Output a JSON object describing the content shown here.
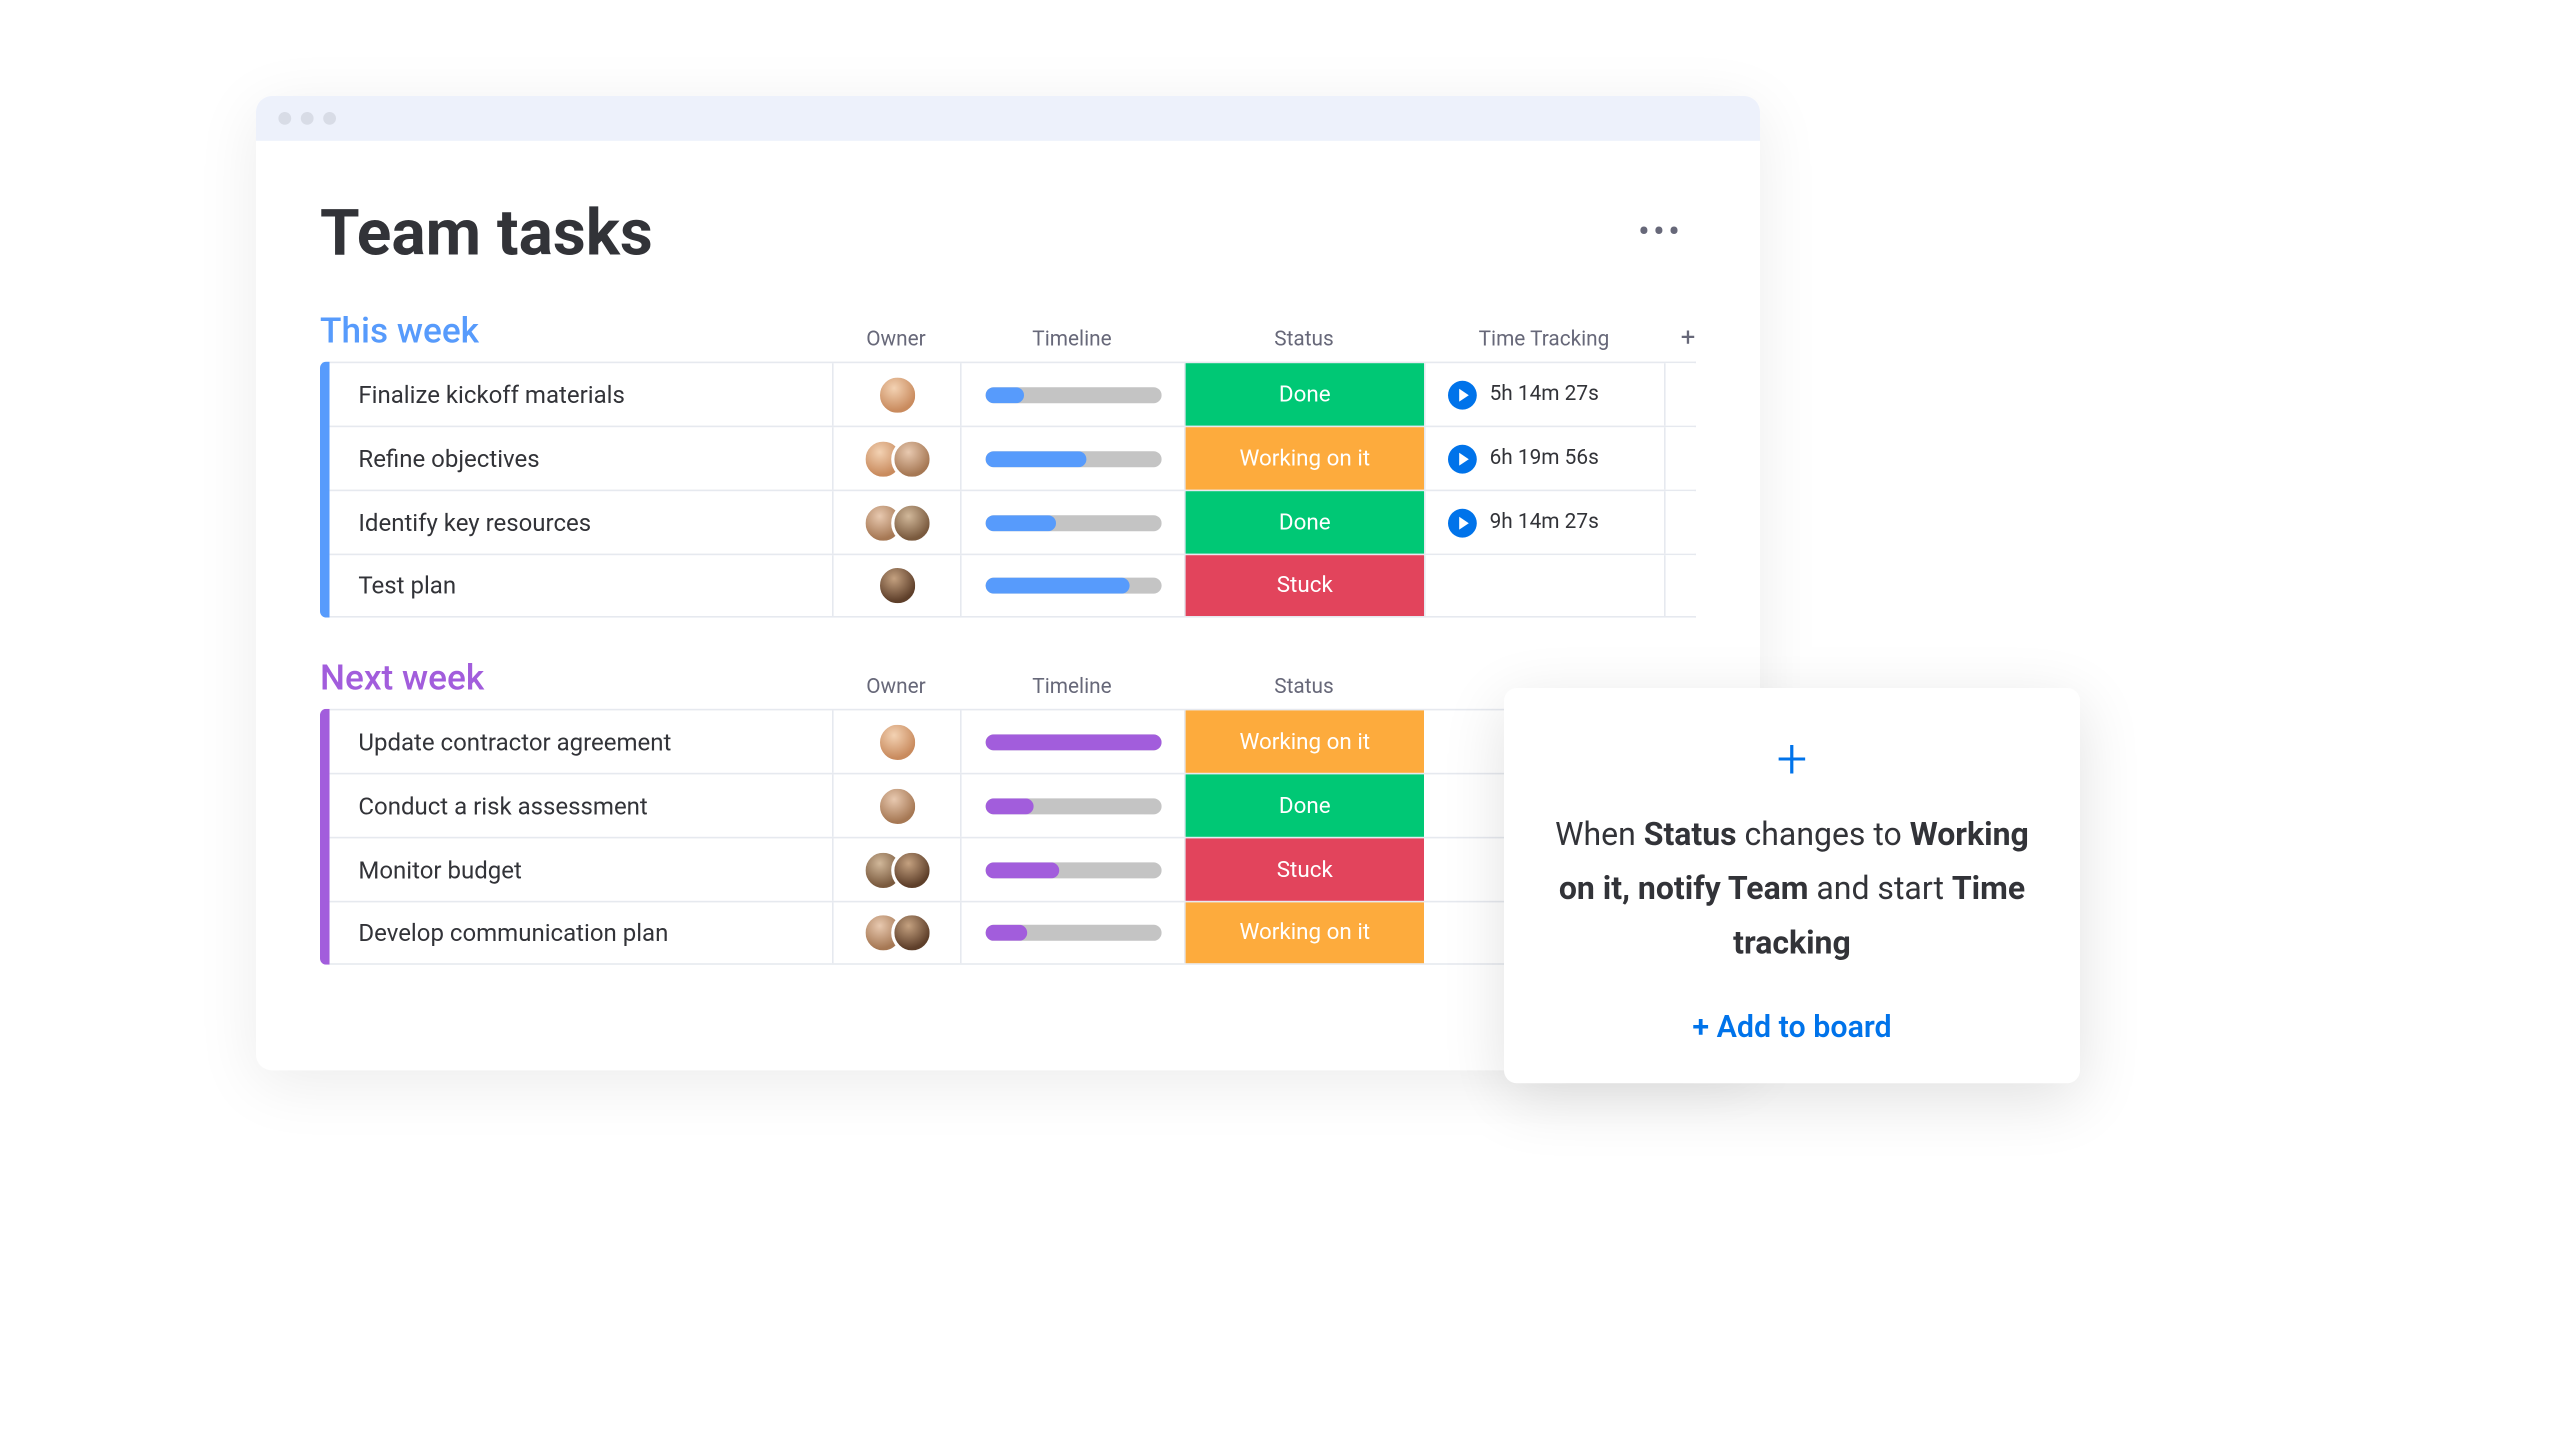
{
  "page_title": "Team tasks",
  "columns": {
    "owner": "Owner",
    "timeline": "Timeline",
    "status": "Status",
    "time_tracking": "Time Tracking"
  },
  "groups": [
    {
      "title": "This week",
      "color": "blue",
      "rows": [
        {
          "name": "Finalize kickoff materials",
          "owners": [
            "av1"
          ],
          "progress": 22,
          "status": "Done",
          "status_class": "done",
          "time": "5h 14m 27s"
        },
        {
          "name": "Refine objectives",
          "owners": [
            "av1",
            "av2"
          ],
          "progress": 58,
          "status": "Working on it",
          "status_class": "working",
          "time": "6h 19m 56s"
        },
        {
          "name": "Identify key resources",
          "owners": [
            "av2",
            "av3"
          ],
          "progress": 40,
          "status": "Done",
          "status_class": "done",
          "time": "9h 14m 27s"
        },
        {
          "name": "Test plan",
          "owners": [
            "av4"
          ],
          "progress": 82,
          "status": "Stuck",
          "status_class": "stuck",
          "time": ""
        }
      ]
    },
    {
      "title": "Next week",
      "color": "purple",
      "rows": [
        {
          "name": "Update contractor agreement",
          "owners": [
            "av1"
          ],
          "progress": 100,
          "status": "Working on it",
          "status_class": "working",
          "time": ""
        },
        {
          "name": "Conduct a risk assessment",
          "owners": [
            "av2"
          ],
          "progress": 28,
          "status": "Done",
          "status_class": "done",
          "time": ""
        },
        {
          "name": "Monitor budget",
          "owners": [
            "av3",
            "av4"
          ],
          "progress": 42,
          "status": "Stuck",
          "status_class": "stuck",
          "time": ""
        },
        {
          "name": "Develop communication plan",
          "owners": [
            "av2",
            "av4"
          ],
          "progress": 24,
          "status": "Working on it",
          "status_class": "working",
          "time": ""
        }
      ]
    }
  ],
  "automation": {
    "text_parts": [
      "When ",
      "Status",
      " changes to ",
      "Working on it, notify Team",
      " and start ",
      "Time tracking"
    ],
    "cta": "+ Add to board"
  }
}
